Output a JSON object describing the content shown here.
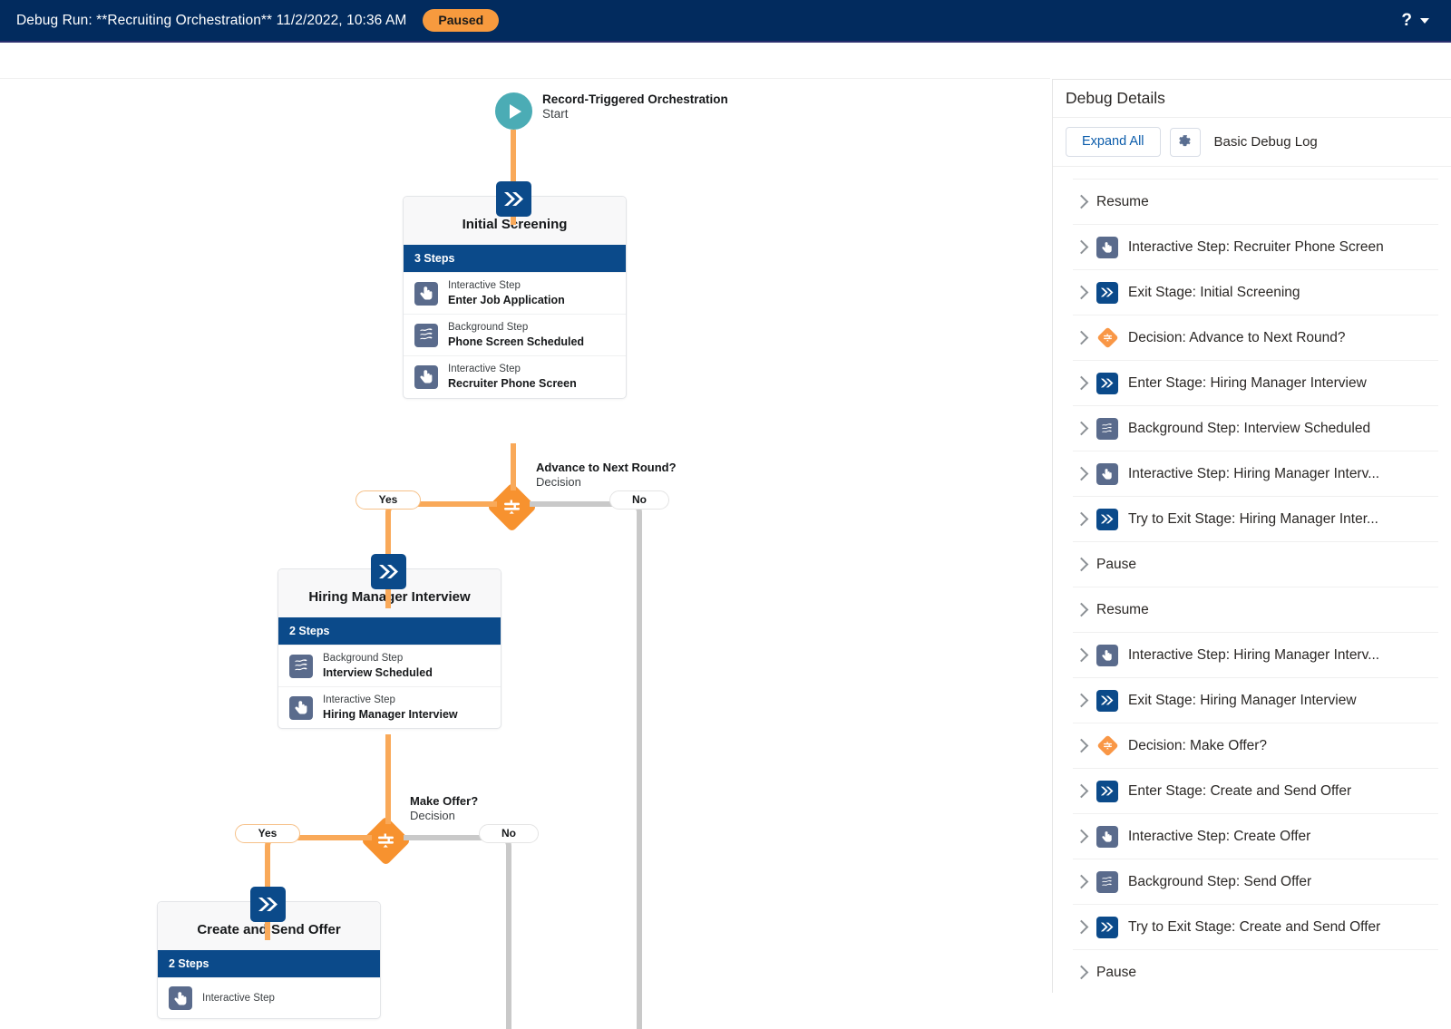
{
  "header": {
    "title": "Debug Run: **Recruiting Orchestration** 11/2/2022, 10:36 AM",
    "status": "Paused",
    "help_icon": "help-question-icon",
    "caret_icon": "chevron-down-icon",
    "background_color": "#022b5e",
    "status_color": "#f79a3e"
  },
  "flow": {
    "start": {
      "title": "Record-Triggered Orchestration",
      "subtitle": "Start",
      "icon": "play-icon",
      "color": "#4bacb5"
    },
    "stages": [
      {
        "name": "Initial Screening",
        "steps_label": "3 Steps",
        "badge_icon": "stage-chevrons-icon",
        "steps": [
          {
            "type": "Interactive Step",
            "name": "Enter Job Application",
            "icon": "interactive-step-hand-icon"
          },
          {
            "type": "Background Step",
            "name": "Phone Screen Scheduled",
            "icon": "background-step-waves-icon"
          },
          {
            "type": "Interactive Step",
            "name": "Recruiter Phone Screen",
            "icon": "interactive-step-hand-icon"
          }
        ]
      },
      {
        "name": "Hiring Manager Interview",
        "steps_label": "2 Steps",
        "badge_icon": "stage-chevrons-icon",
        "steps": [
          {
            "type": "Background Step",
            "name": "Interview Scheduled",
            "icon": "background-step-waves-icon"
          },
          {
            "type": "Interactive Step",
            "name": "Hiring Manager Interview",
            "icon": "interactive-step-hand-icon"
          }
        ]
      },
      {
        "name": "Create and Send Offer",
        "steps_label": "2 Steps",
        "badge_icon": "stage-chevrons-icon",
        "steps": [
          {
            "type": "Interactive Step",
            "name": "",
            "icon": "interactive-step-hand-icon"
          }
        ]
      }
    ],
    "decisions": [
      {
        "title": "Advance to Next Round?",
        "subtitle": "Decision",
        "icon": "decision-diamond-icon",
        "yes_label": "Yes",
        "no_label": "No"
      },
      {
        "title": "Make Offer?",
        "subtitle": "Decision",
        "icon": "decision-diamond-icon",
        "yes_label": "Yes",
        "no_label": "No"
      }
    ],
    "connector_colors": {
      "active": "#f9a959",
      "inactive": "#c9c9c9"
    }
  },
  "details": {
    "title": "Debug Details",
    "expand_all_label": "Expand All",
    "gear_icon": "gear-icon",
    "log_mode_label": "Basic Debug Log",
    "rows": [
      {
        "label": "Resume",
        "icon": null
      },
      {
        "label": "Interactive Step: Recruiter Phone Screen",
        "icon": "interactive-step-hand-icon"
      },
      {
        "label": "Exit Stage: Initial Screening",
        "icon": "stage-chevrons-icon"
      },
      {
        "label": "Decision: Advance to Next Round?",
        "icon": "decision-diamond-icon"
      },
      {
        "label": "Enter Stage: Hiring Manager Interview",
        "icon": "stage-chevrons-icon"
      },
      {
        "label": "Background Step: Interview Scheduled",
        "icon": "background-step-waves-icon"
      },
      {
        "label": "Interactive Step: Hiring Manager Interv...",
        "icon": "interactive-step-hand-icon"
      },
      {
        "label": "Try to Exit Stage: Hiring Manager Inter...",
        "icon": "stage-chevrons-icon"
      },
      {
        "label": "Pause",
        "icon": null
      },
      {
        "label": "Resume",
        "icon": null
      },
      {
        "label": "Interactive Step: Hiring Manager Interv...",
        "icon": "interactive-step-hand-icon"
      },
      {
        "label": "Exit Stage: Hiring Manager Interview",
        "icon": "stage-chevrons-icon"
      },
      {
        "label": "Decision: Make Offer?",
        "icon": "decision-diamond-icon"
      },
      {
        "label": "Enter Stage: Create and Send Offer",
        "icon": "stage-chevrons-icon"
      },
      {
        "label": "Interactive Step: Create Offer",
        "icon": "interactive-step-hand-icon"
      },
      {
        "label": "Background Step: Send Offer",
        "icon": "background-step-waves-icon"
      },
      {
        "label": "Try to Exit Stage: Create and Send Offer",
        "icon": "stage-chevrons-icon"
      },
      {
        "label": "Pause",
        "icon": null
      }
    ]
  }
}
